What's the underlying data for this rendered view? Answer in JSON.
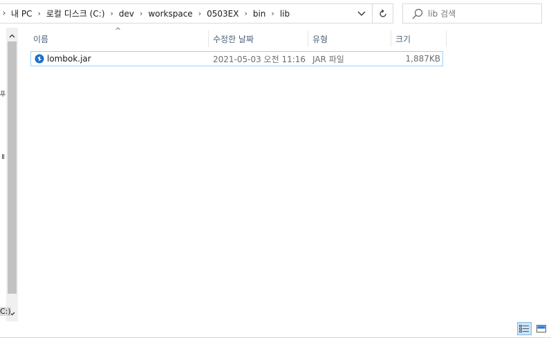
{
  "address_bar": {
    "breadcrumbs": [
      "내 PC",
      "로컬 디스크 (C:)",
      "dev",
      "workspace",
      "0503EX",
      "bin",
      "lib"
    ],
    "dropdown_icon": "chevron-down-icon",
    "refresh_icon": "refresh-icon"
  },
  "search": {
    "placeholder": "lib 검색",
    "icon": "search-icon"
  },
  "nav_pane": {
    "edge_glyphs": [
      "Ⅱ",
      "C:)"
    ],
    "icons": [
      "pin-icon",
      "scroll-up-icon",
      "scroll-down-icon"
    ]
  },
  "columns": {
    "name": "이름",
    "date": "수정한 날짜",
    "type": "유형",
    "size": "크기"
  },
  "files": [
    {
      "name": "lombok.jar",
      "date": "2021-05-03 오전 11:16",
      "type": "JAR 파일",
      "size": "1,887KB",
      "icon": "jar-file-icon"
    }
  ],
  "view_buttons": [
    "details-view-icon",
    "large-icons-view-icon"
  ],
  "colors": {
    "accent": "#99d1ff",
    "selected_view": "#cce4f7",
    "header_text": "#4c607a"
  }
}
